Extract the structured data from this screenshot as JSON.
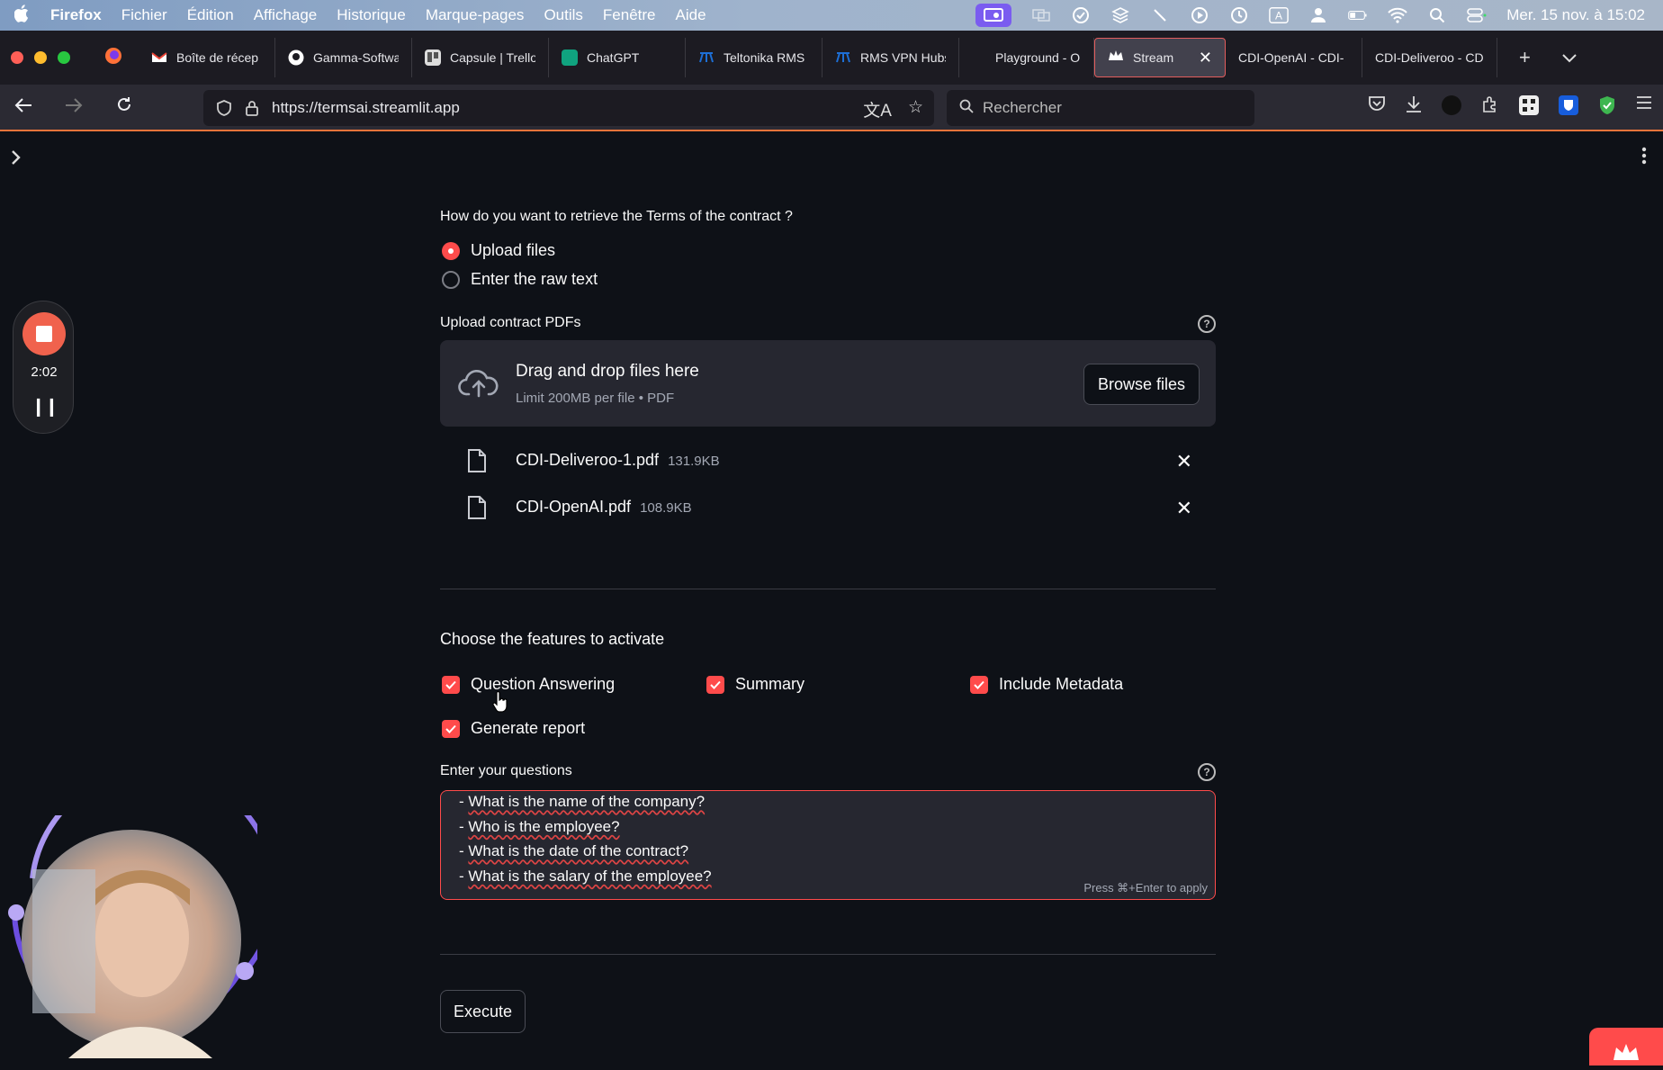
{
  "menubar": {
    "app_name": "Firefox",
    "menus": [
      "Fichier",
      "Édition",
      "Affichage",
      "Historique",
      "Marque-pages",
      "Outils",
      "Fenêtre",
      "Aide"
    ],
    "datetime": "Mer. 15 nov. à 15:02"
  },
  "tabs": [
    {
      "title": "Boîte de récep",
      "color": "#ea4335"
    },
    {
      "title": "Gamma-Softwa",
      "color": "#ffffff"
    },
    {
      "title": "Capsule | Trello",
      "color": "#dddddd"
    },
    {
      "title": "ChatGPT",
      "color": "#10a37f"
    },
    {
      "title": "Teltonika RMS",
      "color": "#1d6fd6"
    },
    {
      "title": "RMS VPN Hubs",
      "color": "#1d6fd6"
    },
    {
      "title": "Playground - O",
      "color": "#1c1b22"
    },
    {
      "title": "Streamlit",
      "color": "#ff4b4b"
    },
    {
      "title": "CDI-OpenAI - CDI-",
      "color": "#1c1b22"
    },
    {
      "title": "CDI-Deliveroo - CD",
      "color": "#1c1b22"
    }
  ],
  "navbar": {
    "url": "https://termsai.streamlit.app",
    "search_placeholder": "Rechercher"
  },
  "form": {
    "retrieve_label": "How do you want to retrieve the Terms of the contract ?",
    "radio_options": [
      "Upload files",
      "Enter the raw text"
    ],
    "radio_selected": "Upload files",
    "upload_label": "Upload contract PDFs",
    "dropzone_title": "Drag and drop files here",
    "dropzone_sub": "Limit 200MB per file • PDF",
    "browse_label": "Browse files",
    "files": [
      {
        "name": "CDI-Deliveroo-1.pdf",
        "size": "131.9KB"
      },
      {
        "name": "CDI-OpenAI.pdf",
        "size": "108.9KB"
      }
    ],
    "features_title": "Choose the features to activate",
    "features": [
      {
        "label": "Question Answering",
        "checked": true
      },
      {
        "label": "Summary",
        "checked": true
      },
      {
        "label": "Include Metadata",
        "checked": true
      },
      {
        "label": "Generate report",
        "checked": true
      }
    ],
    "questions_label": "Enter your questions",
    "questions": [
      "- What is the name of the company?",
      "- Who is the employee?",
      "- What is the date of the contract?",
      "- What is the salary of the employee?"
    ],
    "textarea_hint": "Press ⌘+Enter to apply",
    "execute_label": "Execute"
  },
  "recorder": {
    "elapsed": "2:02"
  },
  "colors": {
    "accent": "#ff4b4b",
    "background": "#0e1117",
    "panel": "#262730"
  }
}
